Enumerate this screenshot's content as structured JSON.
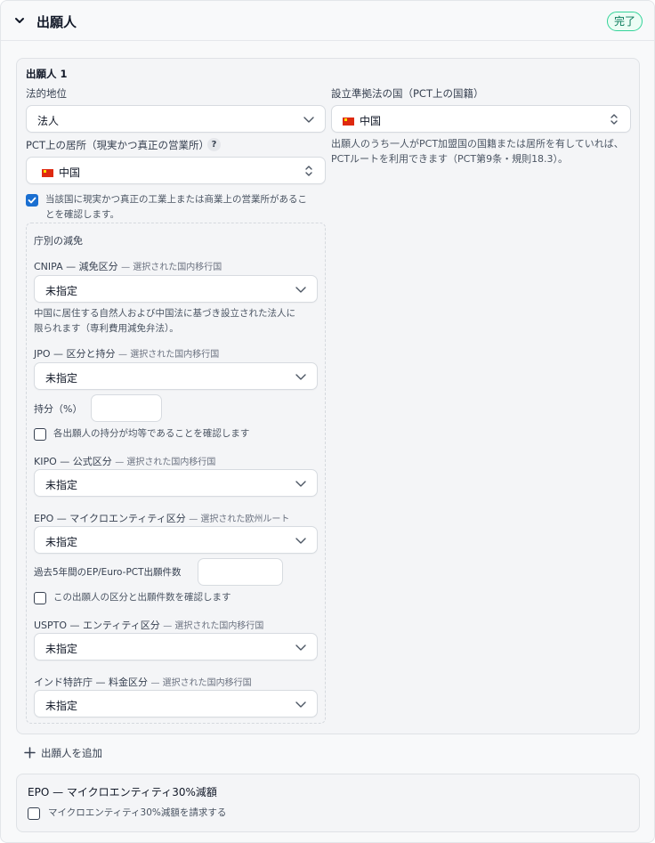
{
  "section": {
    "title": "出願人",
    "status_badge": "完了",
    "colors": {
      "accent": "#1a6fd1",
      "badge_border": "#34d399",
      "badge_bg": "#ecfdf5",
      "badge_text": "#047857"
    }
  },
  "applicant": {
    "heading": "出願人 1",
    "legal_status": {
      "label": "法的地位",
      "value": "法人"
    },
    "country_of_incorporation": {
      "label": "設立準拠法の国（PCT上の国籍）",
      "value": "中国",
      "flag": "china-flag-icon"
    },
    "residence": {
      "label": "PCT上の居所（現実かつ真正の営業所）",
      "help_icon": "?",
      "value": "中国",
      "flag": "china-flag-icon"
    },
    "nationality_note": "出願人のうち一人がPCT加盟国の国籍または居所を有していれば、PCTルートを利用できます（PCT第9条・規則18.3）。",
    "confirm_establishment": {
      "checked": true,
      "line1": "当該国に現実かつ真正の工業上または商業上の営業所があるこ",
      "line2": "とを確認します。"
    },
    "office_reductions": {
      "heading": "庁別の減免",
      "cnipa": {
        "label": "CNIPA — 減免区分",
        "tag": "— 選択された国内移行国",
        "value": "未指定",
        "note_line1": "中国に居住する自然人および中国法に基づき設立された法人に",
        "note_line2": "限られます（専利費用減免弁法）。"
      },
      "jpo": {
        "label": "JPO — 区分と持分",
        "tag": "— 選択された国内移行国",
        "value": "未指定",
        "share_label": "持分（%）",
        "share_value": "",
        "equal_share_check": "各出願人の持分が均等であることを確認します",
        "equal_share_checked": false
      },
      "kipo": {
        "label": "KIPO — 公式区分",
        "tag": "— 選択された国内移行国",
        "value": "未指定"
      },
      "epo": {
        "label": "EPO — マイクロエンティティ区分",
        "tag": "— 選択された欧州ルート",
        "value": "未指定",
        "count_label": "過去5年間のEP/Euro-PCT出願件数",
        "count_value": "",
        "confirm_check": "この出願人の区分と出願件数を確認します",
        "confirm_checked": false
      },
      "uspto": {
        "label": "USPTO — エンティティ区分",
        "tag": "— 選択された国内移行国",
        "value": "未指定"
      },
      "india": {
        "label": "インド特許庁 — 料金区分",
        "tag": "— 選択された国内移行国",
        "value": "未指定"
      }
    }
  },
  "add_applicant": {
    "label": "出願人を追加",
    "icon": "plus-icon"
  },
  "epo_micro": {
    "title": "EPO — マイクロエンティティ30%減額",
    "check_label": "マイクロエンティティ30%減額を請求する",
    "checked": false
  }
}
